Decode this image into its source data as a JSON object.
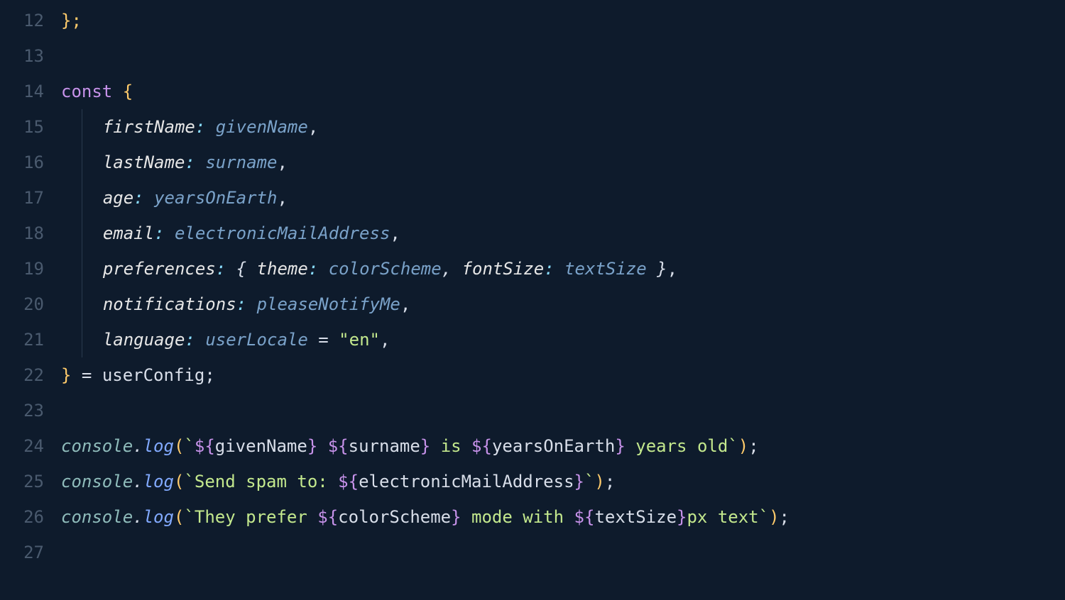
{
  "gutter": {
    "l12": "12",
    "l13": "13",
    "l14": "14",
    "l15": "15",
    "l16": "16",
    "l17": "17",
    "l18": "18",
    "l19": "19",
    "l20": "20",
    "l21": "21",
    "l22": "22",
    "l23": "23",
    "l24": "24",
    "l25": "25",
    "l26": "26",
    "l27": "27"
  },
  "t": {
    "closebrace_semi": "};",
    "const": "const",
    "lbrace": " {",
    "rbrace": "}",
    "rbrace_eq": "} ",
    "eq": "= ",
    "usercfg": "userConfig",
    "semi": ";",
    "comma": ",",
    "colon": ":",
    "sp": " ",
    "indent2": "  ",
    "indent4": "    ",
    "firstName": "firstName",
    "givenName": "givenName",
    "lastName": "lastName",
    "surname": "surname",
    "age": "age",
    "yearsOnEarth": "yearsOnEarth",
    "email": "email",
    "electronicMailAddress": "electronicMailAddress",
    "preferences": "preferences",
    "theme": "theme",
    "colorScheme": "colorScheme",
    "fontSize": "fontSize",
    "textSize": "textSize",
    "lbrace_inner": "{ ",
    "rbrace_inner": " }",
    "notifications": "notifications",
    "pleaseNotifyMe": "pleaseNotifyMe",
    "language": "language",
    "userLocale": "userLocale",
    "eq_def": " = ",
    "str_en": "\"en\"",
    "console": "console",
    "dot": ".",
    "log": "log",
    "lparen": "(",
    "rparen": ")",
    "btick": "`",
    "dopen": "${",
    "dclose": "}",
    "tmpl_sp": " ",
    "tmpl_is": " is ",
    "tmpl_years_old": " years old",
    "tmpl_send": "Send spam to: ",
    "tmpl_prefer": "They prefer ",
    "tmpl_mode": " mode with ",
    "tmpl_px": "px text"
  }
}
